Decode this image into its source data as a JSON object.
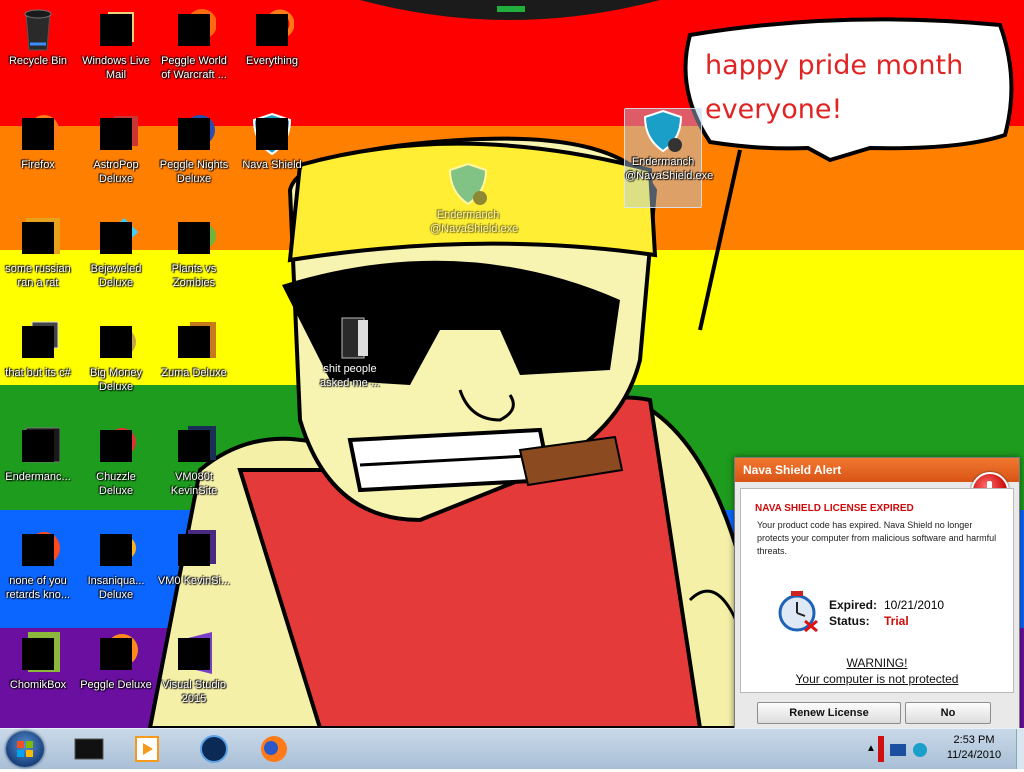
{
  "desktop": {
    "icons": [
      {
        "label": "Recycle Bin"
      },
      {
        "label": "Windows Live Mail"
      },
      {
        "label": "Peggle World of Warcraft ..."
      },
      {
        "label": "Everything"
      },
      {
        "label": "Firefox"
      },
      {
        "label": "AstroPop Deluxe"
      },
      {
        "label": "Peggle Nights Deluxe"
      },
      {
        "label": "Nava Shield"
      },
      {
        "label": "some russian ran a rat"
      },
      {
        "label": "Bejeweled Deluxe"
      },
      {
        "label": "Plants vs Zombies"
      },
      {
        "label": "that but its c#"
      },
      {
        "label": "Big Money Deluxe"
      },
      {
        "label": "Zuma Deluxe"
      },
      {
        "label": "Endermanc..."
      },
      {
        "label": "Chuzzle Deluxe"
      },
      {
        "label": "VM080t KevinSite"
      },
      {
        "label": "none of you retards kno..."
      },
      {
        "label": "Insaniqua... Deluxe"
      },
      {
        "label": "VM0 KevinSi..."
      },
      {
        "label": "ChomikBox"
      },
      {
        "label": "Peggle Deluxe"
      },
      {
        "label": "Visual Studio 2015"
      },
      {
        "label": "Endermanch @NavaShield.exe"
      },
      {
        "label": "Endermanch @NavaShield.exe"
      },
      {
        "label": "shit people asked me ..."
      }
    ],
    "wallpaper_text": "happy pride month everyone!"
  },
  "alert": {
    "title": "Nava Shield Alert",
    "heading": "NAVA SHIELD LICENSE EXPIRED",
    "message": "Your product code has expired. Nava Shield no longer protects your computer from malicious software and harmful threats.",
    "expired_label": "Expired:",
    "expired_value": "10/21/2010",
    "status_label": "Status:",
    "status_value": "Trial",
    "warning_title": "WARNING!",
    "warning_text": "Your computer is not protected",
    "renew_button": "Renew License",
    "no_button": "No",
    "accent_color": "#e8611f",
    "status_color": "#d10a0a"
  },
  "taskbar": {
    "time": "2:53 PM",
    "date": "11/24/2010",
    "pinned": [
      "start-orb",
      "program-icon",
      "media-player-icon",
      "browser-icon",
      "firefox-icon"
    ]
  },
  "colors": {
    "stripes": [
      "#ff0000",
      "#ff7f00",
      "#ffff00",
      "#1e9c1e",
      "#0a66ff",
      "#6a0fa0"
    ]
  }
}
